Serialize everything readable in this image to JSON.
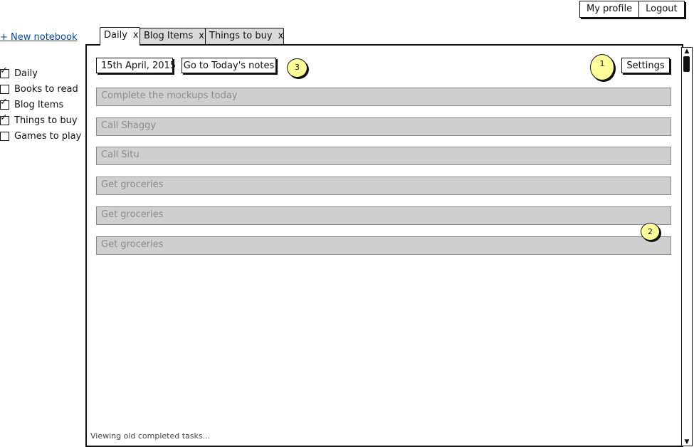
{
  "header": {
    "my_profile": "My profile",
    "logout": "Logout"
  },
  "sidebar": {
    "new_notebook": "+ New notebook",
    "notebooks": [
      {
        "label": "Daily",
        "checked": true
      },
      {
        "label": "Books to read",
        "checked": false
      },
      {
        "label": "Blog Items",
        "checked": true
      },
      {
        "label": "Things to buy",
        "checked": true
      },
      {
        "label": "Games to play",
        "checked": false
      }
    ]
  },
  "tabs": [
    {
      "label": "Daily",
      "close": "x",
      "active": true
    },
    {
      "label": "Blog Items",
      "close": "x",
      "active": false
    },
    {
      "label": "Things to buy",
      "close": "x",
      "active": false
    }
  ],
  "toolbar": {
    "date": "15th April, 2015",
    "today_button": "Go to Today's notes",
    "settings_button": "Settings"
  },
  "notes": [
    "Complete the mockups today",
    "Call Shaggy",
    "Call Situ",
    "Get groceries",
    "Get groceries",
    "Get groceries"
  ],
  "status_text": "Viewing old completed tasks...",
  "callouts": {
    "one": "1",
    "two": "2",
    "three": "3"
  },
  "colors": {
    "callout": "#ffff99",
    "note_row": "#cfcfcf",
    "link": "#0645ad",
    "inactive_tab": "#d9d9d9"
  }
}
